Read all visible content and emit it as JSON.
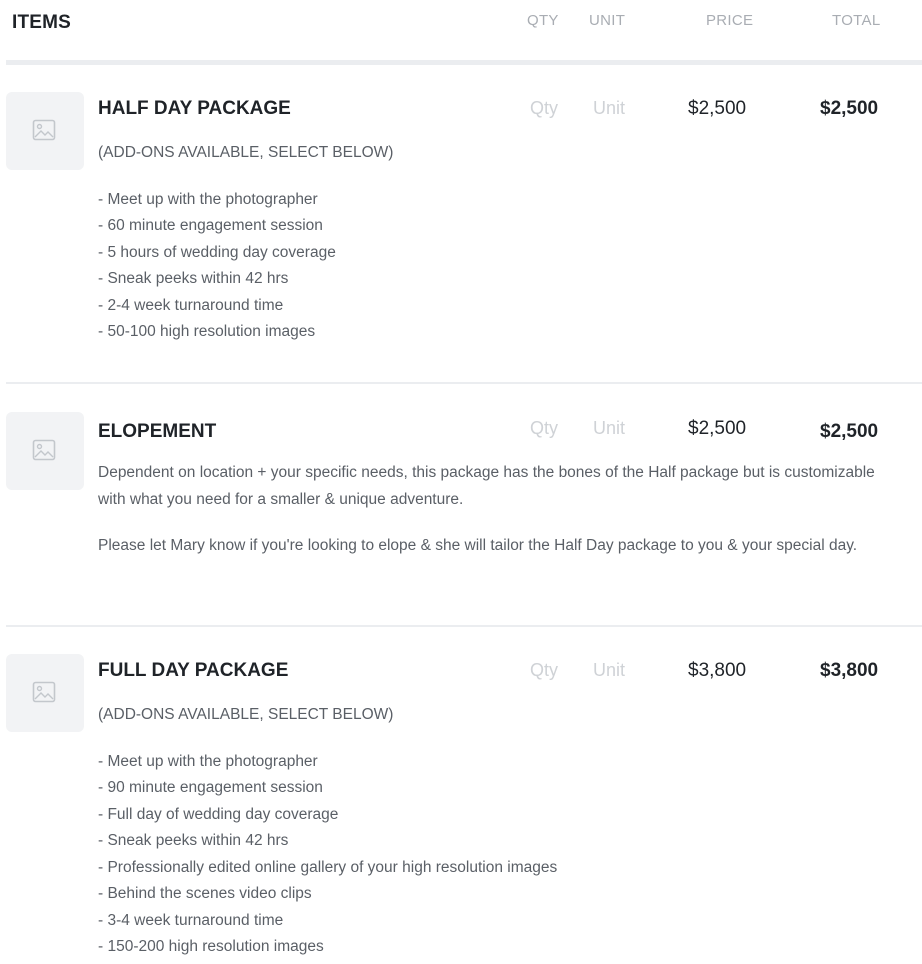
{
  "header": {
    "items_title": "ITEMS",
    "qty": "QTY",
    "unit": "UNIT",
    "price": "PRICE",
    "total": "TOTAL"
  },
  "items": [
    {
      "name": "HALF DAY PACKAGE",
      "qty_placeholder": "Qty",
      "unit_placeholder": "Unit",
      "price": "$2,500",
      "total": "$2,500",
      "subtitle": "(ADD-ONS AVAILABLE, SELECT BELOW)",
      "features": [
        "- Meet up with the photographer",
        "- 60 minute engagement session",
        "- 5 hours of wedding day coverage",
        "- Sneak peeks within 42 hrs",
        "- 2-4 week turnaround time",
        "- 50-100 high resolution images"
      ],
      "thumb_icon": "image-placeholder-icon"
    },
    {
      "name": "ELOPEMENT",
      "qty_placeholder": "Qty",
      "unit_placeholder": "Unit",
      "price": "$2,500",
      "total": "$2,500",
      "paragraphs": [
        "Dependent on location + your specific needs, this package has the bones of the Half package but is customizable with what you need for a smaller & unique adventure.",
        "Please let Mary know if you're looking to elope & she will tailor the Half Day package to you & your special day."
      ],
      "thumb_icon": "image-placeholder-icon"
    },
    {
      "name": "FULL DAY PACKAGE",
      "qty_placeholder": "Qty",
      "unit_placeholder": "Unit",
      "price": "$3,800",
      "total": "$3,800",
      "subtitle": "(ADD-ONS AVAILABLE, SELECT BELOW)",
      "features": [
        "- Meet up with the photographer",
        "- 90 minute engagement session",
        "- Full day of wedding day coverage",
        "- Sneak peeks within 42 hrs",
        "- Professionally edited online gallery of your high resolution images",
        "- Behind the scenes video clips",
        "- 3-4 week turnaround time",
        "- 150-200 high resolution images"
      ],
      "thumb_icon": "image-placeholder-icon"
    }
  ],
  "colors": {
    "header_label": "#a9adb3",
    "title": "#1f2328",
    "placeholder": "#cfd2d6",
    "body_text": "#5a5f66",
    "divider": "#ebedf0",
    "thumb_bg": "#f2f3f5"
  }
}
